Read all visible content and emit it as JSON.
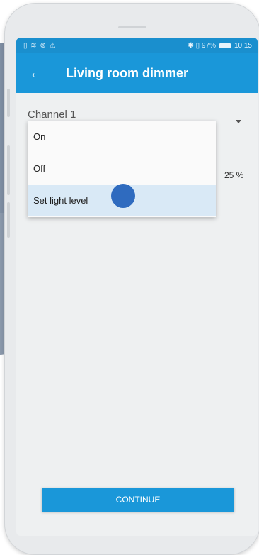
{
  "status": {
    "left_icons": "▯ ≋ ⊚ ⚠",
    "right_text": "✱ ▯ 97%",
    "time": "10:15"
  },
  "appbar": {
    "back_icon": "←",
    "title": "Living room dimmer"
  },
  "channel": {
    "label": "Channel 1"
  },
  "level": {
    "value_text": "25 %"
  },
  "menu": {
    "items": [
      {
        "label": "On"
      },
      {
        "label": "Off"
      },
      {
        "label": "Set light level"
      }
    ]
  },
  "footer": {
    "continue_label": "CONTINUE"
  },
  "colors": {
    "primary": "#1a97d9",
    "selected": "#d9e9f6"
  }
}
